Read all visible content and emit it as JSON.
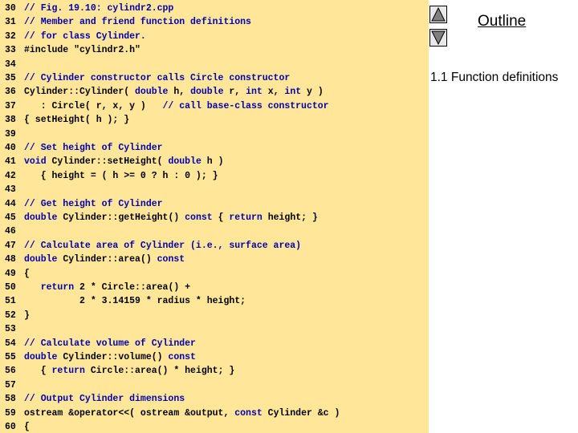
{
  "code": {
    "lines": [
      {
        "num": "30",
        "segs": [
          {
            "t": "// Fig. 19.10: cylindr2.cpp",
            "k": "cm"
          }
        ]
      },
      {
        "num": "31",
        "segs": [
          {
            "t": "// Member and friend function definitions",
            "k": "cm"
          }
        ]
      },
      {
        "num": "32",
        "segs": [
          {
            "t": "// for class Cylinder.",
            "k": "cm"
          }
        ]
      },
      {
        "num": "33",
        "segs": [
          {
            "t": "#include \"cylindr2.h\"",
            "k": "n"
          }
        ]
      },
      {
        "num": "34",
        "segs": []
      },
      {
        "num": "35",
        "segs": [
          {
            "t": "// Cylinder constructor calls Circle constructor",
            "k": "cm"
          }
        ]
      },
      {
        "num": "36",
        "segs": [
          {
            "t": "Cylinder::Cylinder( ",
            "k": "n"
          },
          {
            "t": "double",
            "k": "kw"
          },
          {
            "t": " h, ",
            "k": "n"
          },
          {
            "t": "double",
            "k": "kw"
          },
          {
            "t": " r, ",
            "k": "n"
          },
          {
            "t": "int",
            "k": "kw"
          },
          {
            "t": " x, ",
            "k": "n"
          },
          {
            "t": "int",
            "k": "kw"
          },
          {
            "t": " y )",
            "k": "n"
          }
        ]
      },
      {
        "num": "37",
        "segs": [
          {
            "t": "   : Circle( r, x, y )   ",
            "k": "n"
          },
          {
            "t": "// call base-class constructor",
            "k": "cm"
          }
        ]
      },
      {
        "num": "38",
        "segs": [
          {
            "t": "{ setHeight( h ); }",
            "k": "n"
          }
        ]
      },
      {
        "num": "39",
        "segs": []
      },
      {
        "num": "40",
        "segs": [
          {
            "t": "// Set height of Cylinder",
            "k": "cm"
          }
        ]
      },
      {
        "num": "41",
        "segs": [
          {
            "t": "void",
            "k": "kw"
          },
          {
            "t": " Cylinder::setHeight( ",
            "k": "n"
          },
          {
            "t": "double",
            "k": "kw"
          },
          {
            "t": " h )",
            "k": "n"
          }
        ]
      },
      {
        "num": "42",
        "segs": [
          {
            "t": "   { height = ( h >= 0 ? h : 0 ); }",
            "k": "n"
          }
        ]
      },
      {
        "num": "43",
        "segs": []
      },
      {
        "num": "44",
        "segs": [
          {
            "t": "// Get height of Cylinder",
            "k": "cm"
          }
        ]
      },
      {
        "num": "45",
        "segs": [
          {
            "t": "double",
            "k": "kw"
          },
          {
            "t": " Cylinder::getHeight() ",
            "k": "n"
          },
          {
            "t": "const",
            "k": "kw"
          },
          {
            "t": " { ",
            "k": "n"
          },
          {
            "t": "return",
            "k": "kw"
          },
          {
            "t": " height; }",
            "k": "n"
          }
        ]
      },
      {
        "num": "46",
        "segs": []
      },
      {
        "num": "47",
        "segs": [
          {
            "t": "// Calculate area of Cylinder (i.e., surface area)",
            "k": "cm"
          }
        ]
      },
      {
        "num": "48",
        "segs": [
          {
            "t": "double",
            "k": "kw"
          },
          {
            "t": " Cylinder::area() ",
            "k": "n"
          },
          {
            "t": "const",
            "k": "kw"
          }
        ]
      },
      {
        "num": "49",
        "segs": [
          {
            "t": "{",
            "k": "n"
          }
        ]
      },
      {
        "num": "50",
        "segs": [
          {
            "t": "   ",
            "k": "n"
          },
          {
            "t": "return",
            "k": "kw"
          },
          {
            "t": " 2 * Circle::area() +",
            "k": "n"
          }
        ]
      },
      {
        "num": "51",
        "segs": [
          {
            "t": "          2 * 3.14159 * radius * height;",
            "k": "n"
          }
        ]
      },
      {
        "num": "52",
        "segs": [
          {
            "t": "}",
            "k": "n"
          }
        ]
      },
      {
        "num": "53",
        "segs": []
      },
      {
        "num": "54",
        "segs": [
          {
            "t": "// Calculate volume of Cylinder",
            "k": "cm"
          }
        ]
      },
      {
        "num": "55",
        "segs": [
          {
            "t": "double",
            "k": "kw"
          },
          {
            "t": " Cylinder::volume() ",
            "k": "n"
          },
          {
            "t": "const",
            "k": "kw"
          }
        ]
      },
      {
        "num": "56",
        "segs": [
          {
            "t": "   { ",
            "k": "n"
          },
          {
            "t": "return",
            "k": "kw"
          },
          {
            "t": " Circle::area() * height; }",
            "k": "n"
          }
        ]
      },
      {
        "num": "57",
        "segs": []
      },
      {
        "num": "58",
        "segs": [
          {
            "t": "// Output Cylinder dimensions",
            "k": "cm"
          }
        ]
      },
      {
        "num": "59",
        "segs": [
          {
            "t": "ostream &operator<<( ostream &output, ",
            "k": "n"
          },
          {
            "t": "const",
            "k": "kw"
          },
          {
            "t": " Cylinder &c )",
            "k": "n"
          }
        ]
      },
      {
        "num": "60",
        "segs": [
          {
            "t": "{",
            "k": "n"
          }
        ]
      }
    ]
  },
  "outline": {
    "title": "Outline",
    "item": "1.1 Function definitions"
  },
  "nav": {
    "up_icon": "triangle-up-icon",
    "down_icon": "triangle-down-icon"
  },
  "colors": {
    "code_background": "#ffe699",
    "keyword": "#0000b0",
    "comment": "#0000b0",
    "text": "#000000"
  }
}
